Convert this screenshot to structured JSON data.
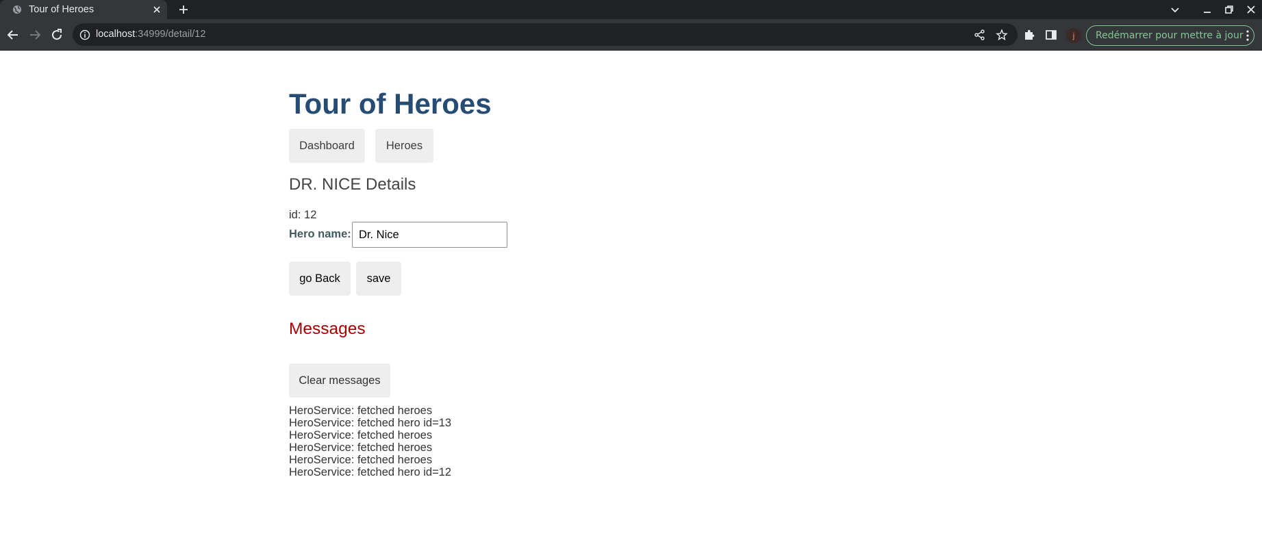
{
  "browser": {
    "tab_title": "Tour of Heroes",
    "url_host": "localhost",
    "url_rest": ":34999/detail/12",
    "profile_initial": "j",
    "update_label": "Redémarrer pour mettre à jour"
  },
  "app": {
    "title": "Tour of Heroes",
    "nav": {
      "dashboard": "Dashboard",
      "heroes": "Heroes"
    },
    "detail": {
      "title": "DR. NICE Details",
      "id_label": "id: ",
      "id_value": "12",
      "name_label": "Hero name: ",
      "name_value": "Dr. Nice",
      "back_label": "go Back",
      "save_label": "save"
    },
    "messages": {
      "title": "Messages",
      "clear_label": "Clear messages",
      "items": [
        "HeroService: fetched heroes",
        "HeroService: fetched hero id=13",
        "HeroService: fetched heroes",
        "HeroService: fetched heroes",
        "HeroService: fetched heroes",
        "HeroService: fetched hero id=12"
      ]
    }
  },
  "colors": {
    "title": "#264c73",
    "messages_title": "#a80000",
    "button_bg": "#eeeeee",
    "update_accent": "#81c995"
  }
}
